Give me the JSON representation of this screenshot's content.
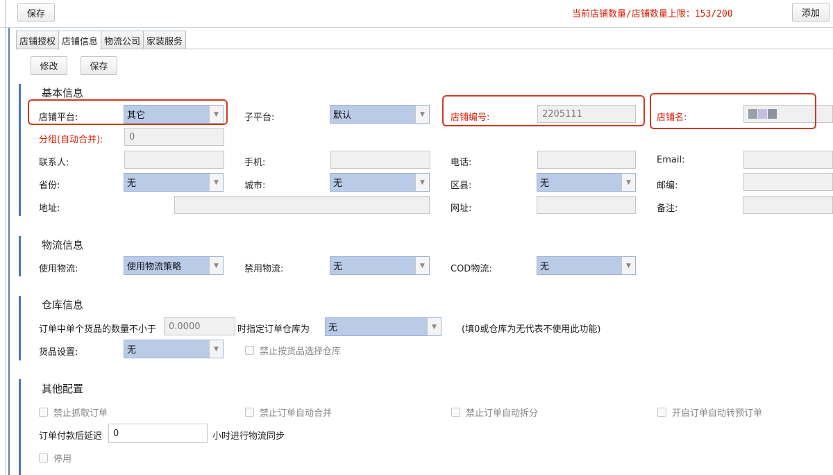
{
  "toolbar": {
    "save_label": "保存",
    "add_label": "添加",
    "counter_text": "当前店铺数量/店铺数量上限：153/200"
  },
  "tabs": [
    {
      "label": "店铺授权"
    },
    {
      "label": "店铺信息",
      "active": true
    },
    {
      "label": "物流公司"
    },
    {
      "label": "家装服务"
    }
  ],
  "form_actions": {
    "edit_label": "修改",
    "save_label": "保存"
  },
  "basic": {
    "title": "基本信息",
    "platform_label": "店铺平台:",
    "platform_value": "其它",
    "subplatform_label": "子平台:",
    "subplatform_value": "默认",
    "shop_no_label": "店铺编号:",
    "shop_no_value": "2205111",
    "shop_name_label": "店铺名:",
    "group_label": "分组(自动合并):",
    "group_value": "0",
    "contact_label": "联系人:",
    "mobile_label": "手机:",
    "phone_label": "电话:",
    "email_label": "Email:",
    "province_label": "省份:",
    "province_value": "无",
    "city_label": "城市:",
    "city_value": "无",
    "district_label": "区县:",
    "district_value": "无",
    "zip_label": "邮编:",
    "address_label": "地址:",
    "website_label": "网址:",
    "remark_label": "备注:"
  },
  "logistics": {
    "title": "物流信息",
    "use_label": "使用物流:",
    "use_value": "使用物流策略",
    "ban_label": "禁用物流:",
    "ban_value": "无",
    "cod_label": "COD物流:",
    "cod_value": "无"
  },
  "warehouse": {
    "title": "仓库信息",
    "qty_prefix": "订单中单个货品的数量不小于",
    "qty_value": "0.0000",
    "qty_suffix": "时指定订单仓库为",
    "wh_value": "无",
    "hint": "(填0或仓库为无代表不使用此功能)",
    "goods_label": "货品设置:",
    "goods_value": "无",
    "ban_select_label": "禁止按货品选择仓库"
  },
  "other": {
    "title": "其他配置",
    "ban_fetch": "禁止抓取订单",
    "ban_merge": "禁止订单自动合并",
    "ban_split": "禁止订单自动拆分",
    "auto_preorder": "开启订单自动转预订单",
    "delay_prefix": "订单付款后延迟",
    "delay_value": "0",
    "delay_suffix": "小时进行物流同步",
    "disable_label": "停用"
  }
}
